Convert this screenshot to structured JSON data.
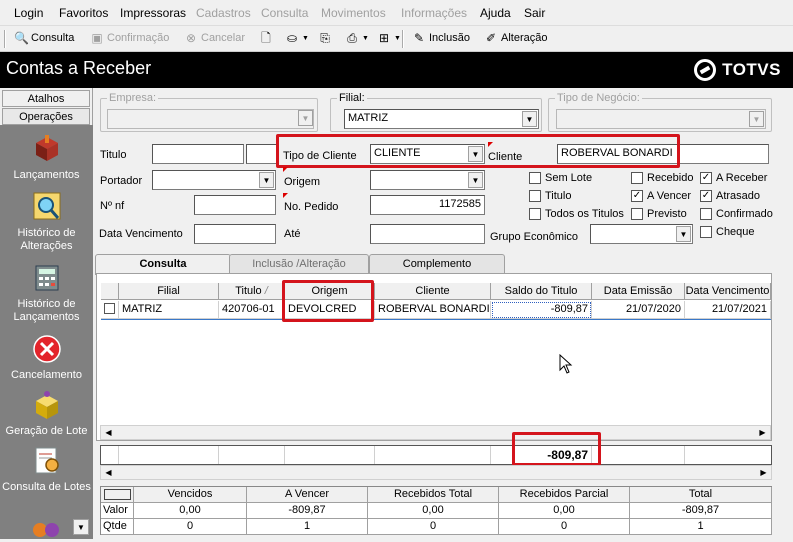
{
  "menu": [
    "Login",
    "Favoritos",
    "Impressoras",
    "Cadastros",
    "Consulta",
    "Movimentos",
    "Informações",
    "Ajuda",
    "Sair"
  ],
  "toolbar": {
    "consulta": "Consulta",
    "confirmacao": "Confirmação",
    "cancelar": "Cancelar",
    "inclusao": "Inclusão",
    "alteracao": "Alteração"
  },
  "title": "Contas a Receber",
  "brand": "TOTVS",
  "sidebar": {
    "tab_atalhos": "Atalhos",
    "tab_operacoes": "Operações",
    "items": [
      "Lançamentos",
      "Histórico de Alterações",
      "Histórico de Lançamentos",
      "Cancelamento",
      "Geração de Lote",
      "Consulta de Lotes"
    ]
  },
  "filters": {
    "empresa_label": "Empresa:",
    "empresa_value": "",
    "filial_label": "Filial:",
    "filial_value": "MATRIZ",
    "tipo_negocio_label": "Tipo de Negócio:",
    "titulo_label": "Titulo",
    "tipo_cliente_label": "Tipo de Cliente",
    "tipo_cliente_value": "CLIENTE",
    "cliente_label": "Cliente",
    "cliente_value": "ROBERVAL BONARDI",
    "portador_label": "Portador",
    "origem_label": "Origem",
    "nnf_label": "Nº nf",
    "pedido_label": "No. Pedido",
    "pedido_value": "1172585",
    "venc_label": "Data Vencimento",
    "ate_label": "Até",
    "grupo_label": "Grupo Econômico"
  },
  "checks": [
    {
      "label": "Sem Lote",
      "checked": false
    },
    {
      "label": "Recebido",
      "checked": false
    },
    {
      "label": "A Receber",
      "checked": true
    },
    {
      "label": "Titulo",
      "checked": false
    },
    {
      "label": "A Vencer",
      "checked": true
    },
    {
      "label": "Atrasado",
      "checked": true
    },
    {
      "label": "Todos os Titulos",
      "checked": false
    },
    {
      "label": "Previsto",
      "checked": false
    },
    {
      "label": "Confirmado",
      "checked": false
    },
    {
      "label": "Cheque",
      "checked": false
    }
  ],
  "tabs": [
    "Consulta",
    "Inclusão /Alteração",
    "Complemento"
  ],
  "grid": {
    "headers": [
      "Filial",
      "Titulo",
      "Origem",
      "Cliente",
      "Saldo do Titulo",
      "Data Emissão",
      "Data Vencimento"
    ],
    "titulo_sort": "/",
    "row": [
      "MATRIZ",
      "420706-01",
      "DEVOLCRED",
      "ROBERVAL BONARDI",
      "-809,87",
      "21/07/2020",
      "21/07/2021"
    ],
    "total": "-809,87"
  },
  "summary": {
    "headers": [
      "Vencidos",
      "A Vencer",
      "Recebidos Total",
      "Recebidos Parcial",
      "Total"
    ],
    "rows": [
      {
        "label": "Valor",
        "values": [
          "0,00",
          "-809,87",
          "0,00",
          "0,00",
          "-809,87"
        ]
      },
      {
        "label": "Qtde",
        "values": [
          "0",
          "1",
          "0",
          "0",
          "1"
        ]
      }
    ]
  }
}
